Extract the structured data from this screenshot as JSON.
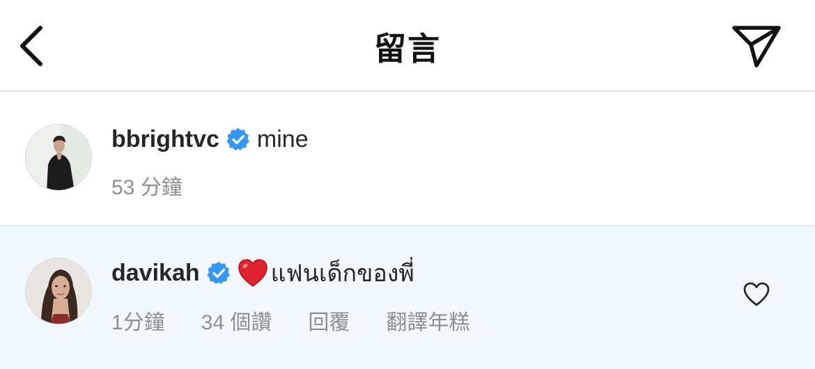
{
  "header": {
    "title": "留言",
    "back_icon": "chevron-left-icon",
    "share_icon": "paper-plane-icon"
  },
  "comments": [
    {
      "username": "bbrightvc",
      "verified": true,
      "text": "mine",
      "time": "53 分鐘"
    },
    {
      "username": "davikah",
      "verified": true,
      "emoji": "red-heart",
      "text": "แฟนเด็กของพี่",
      "time": "1分鐘",
      "likes": "34 個讚",
      "reply_label": "回覆",
      "translate_label": "翻譯年糕",
      "like_icon": "heart-outline-icon"
    }
  ],
  "colors": {
    "verified_badge": "#3897f0",
    "reply_highlight_bg": "#f2f8fd",
    "meta_text": "#8e8e8e",
    "divider": "#dbdbdb"
  }
}
